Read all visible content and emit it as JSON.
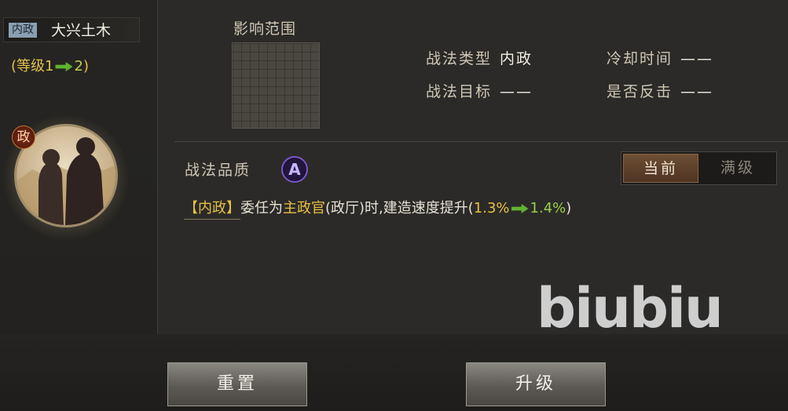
{
  "skill": {
    "type_tag": "内政",
    "name": "大兴土木",
    "level_open": "(等级1",
    "level_to": "2",
    "level_close": ")",
    "category_badge": "政"
  },
  "area": {
    "label": "影响范围"
  },
  "info": {
    "type_key": "战法类型",
    "type_value": "内政",
    "target_key": "战法目标",
    "target_value": "——",
    "cooldown_key": "冷却时间",
    "cooldown_value": "——",
    "counter_key": "是否反击",
    "counter_value": "——"
  },
  "quality": {
    "label": "战法品质",
    "grade": "A",
    "grade_color": "#7a56c8"
  },
  "toggle": {
    "current": "当前",
    "max": "满级",
    "selected": "当前"
  },
  "description": {
    "tag": "【内政】",
    "part1": "委任为",
    "highlight": "主政官",
    "part2": "(政厅)时,建造速度提升(",
    "old_value": "1.3%",
    "new_value": "1.4%",
    "end": ")"
  },
  "watermark": "biubiu",
  "buttons": {
    "reset": "重置",
    "upgrade": "升级"
  },
  "colors": {
    "arrow": "#5fb32d",
    "gold": "#e8c044",
    "green": "#9ccf4a"
  }
}
